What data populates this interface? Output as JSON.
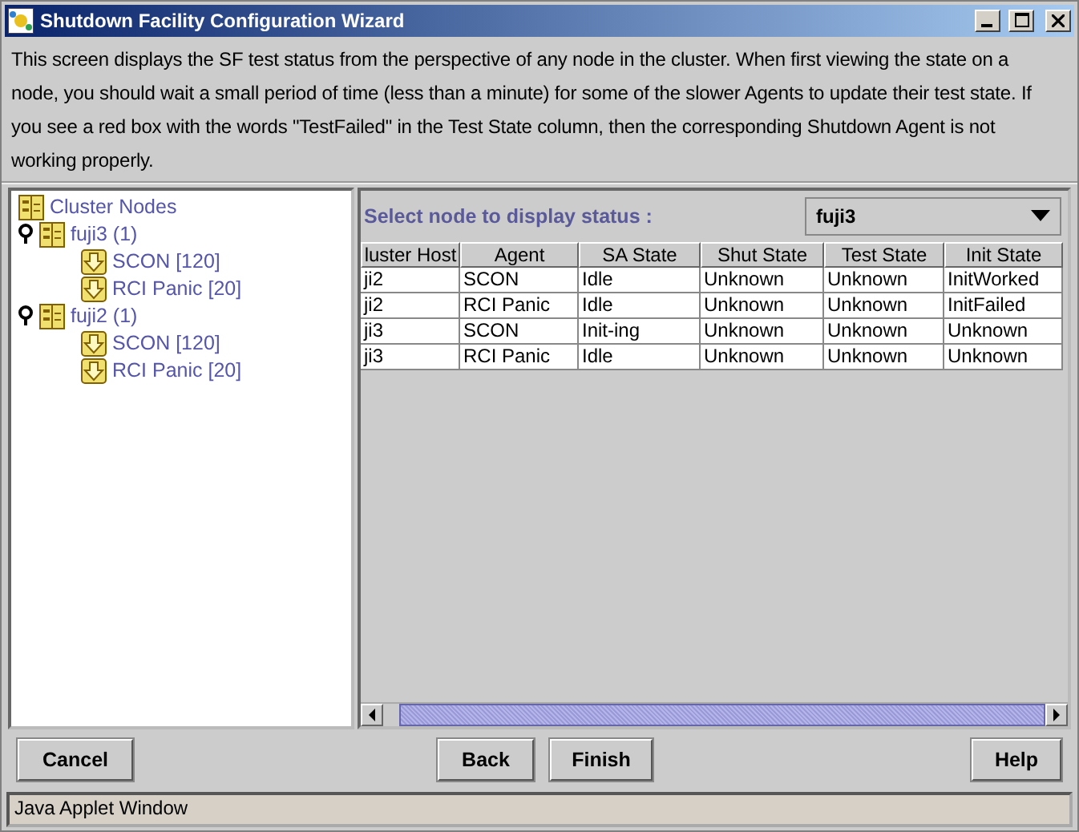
{
  "window": {
    "title": "Shutdown Facility Configuration Wizard"
  },
  "description": "This screen displays the SF test status from the perspective of any node in the cluster. When first viewing the state on a node, you should wait a small period of time (less than a minute) for some of the slower Agents to update their test state. If you see a red box with the words \"TestFailed\" in the Test State column, then the corresponding Shutdown Agent is not working properly.",
  "tree": {
    "label": "Cluster Nodes",
    "children": [
      {
        "label": "fuji3 (1)",
        "expanded": true,
        "children": [
          {
            "label": "SCON [120]"
          },
          {
            "label": "RCI Panic [20]"
          }
        ]
      },
      {
        "label": "fuji2 (1)",
        "expanded": true,
        "children": [
          {
            "label": "SCON [120]"
          },
          {
            "label": "RCI Panic [20]"
          }
        ]
      }
    ]
  },
  "node_select": {
    "label": "Select node to display status :",
    "value": "fuji3"
  },
  "table": {
    "columns": [
      "luster Host",
      "Agent",
      "SA State",
      "Shut State",
      "Test State",
      "Init State"
    ],
    "rows": [
      [
        "ji2",
        "SCON",
        "Idle",
        "Unknown",
        "Unknown",
        "InitWorked"
      ],
      [
        "ji2",
        "RCI Panic",
        "Idle",
        "Unknown",
        "Unknown",
        "InitFailed"
      ],
      [
        "ji3",
        "SCON",
        "Init-ing",
        "Unknown",
        "Unknown",
        "Unknown"
      ],
      [
        "ji3",
        "RCI Panic",
        "Idle",
        "Unknown",
        "Unknown",
        "Unknown"
      ]
    ]
  },
  "buttons": {
    "left": [
      "Cancel"
    ],
    "middle": [
      "Back",
      "Finish"
    ],
    "right": [
      "Help"
    ]
  },
  "status_bar": "Java Applet Window"
}
